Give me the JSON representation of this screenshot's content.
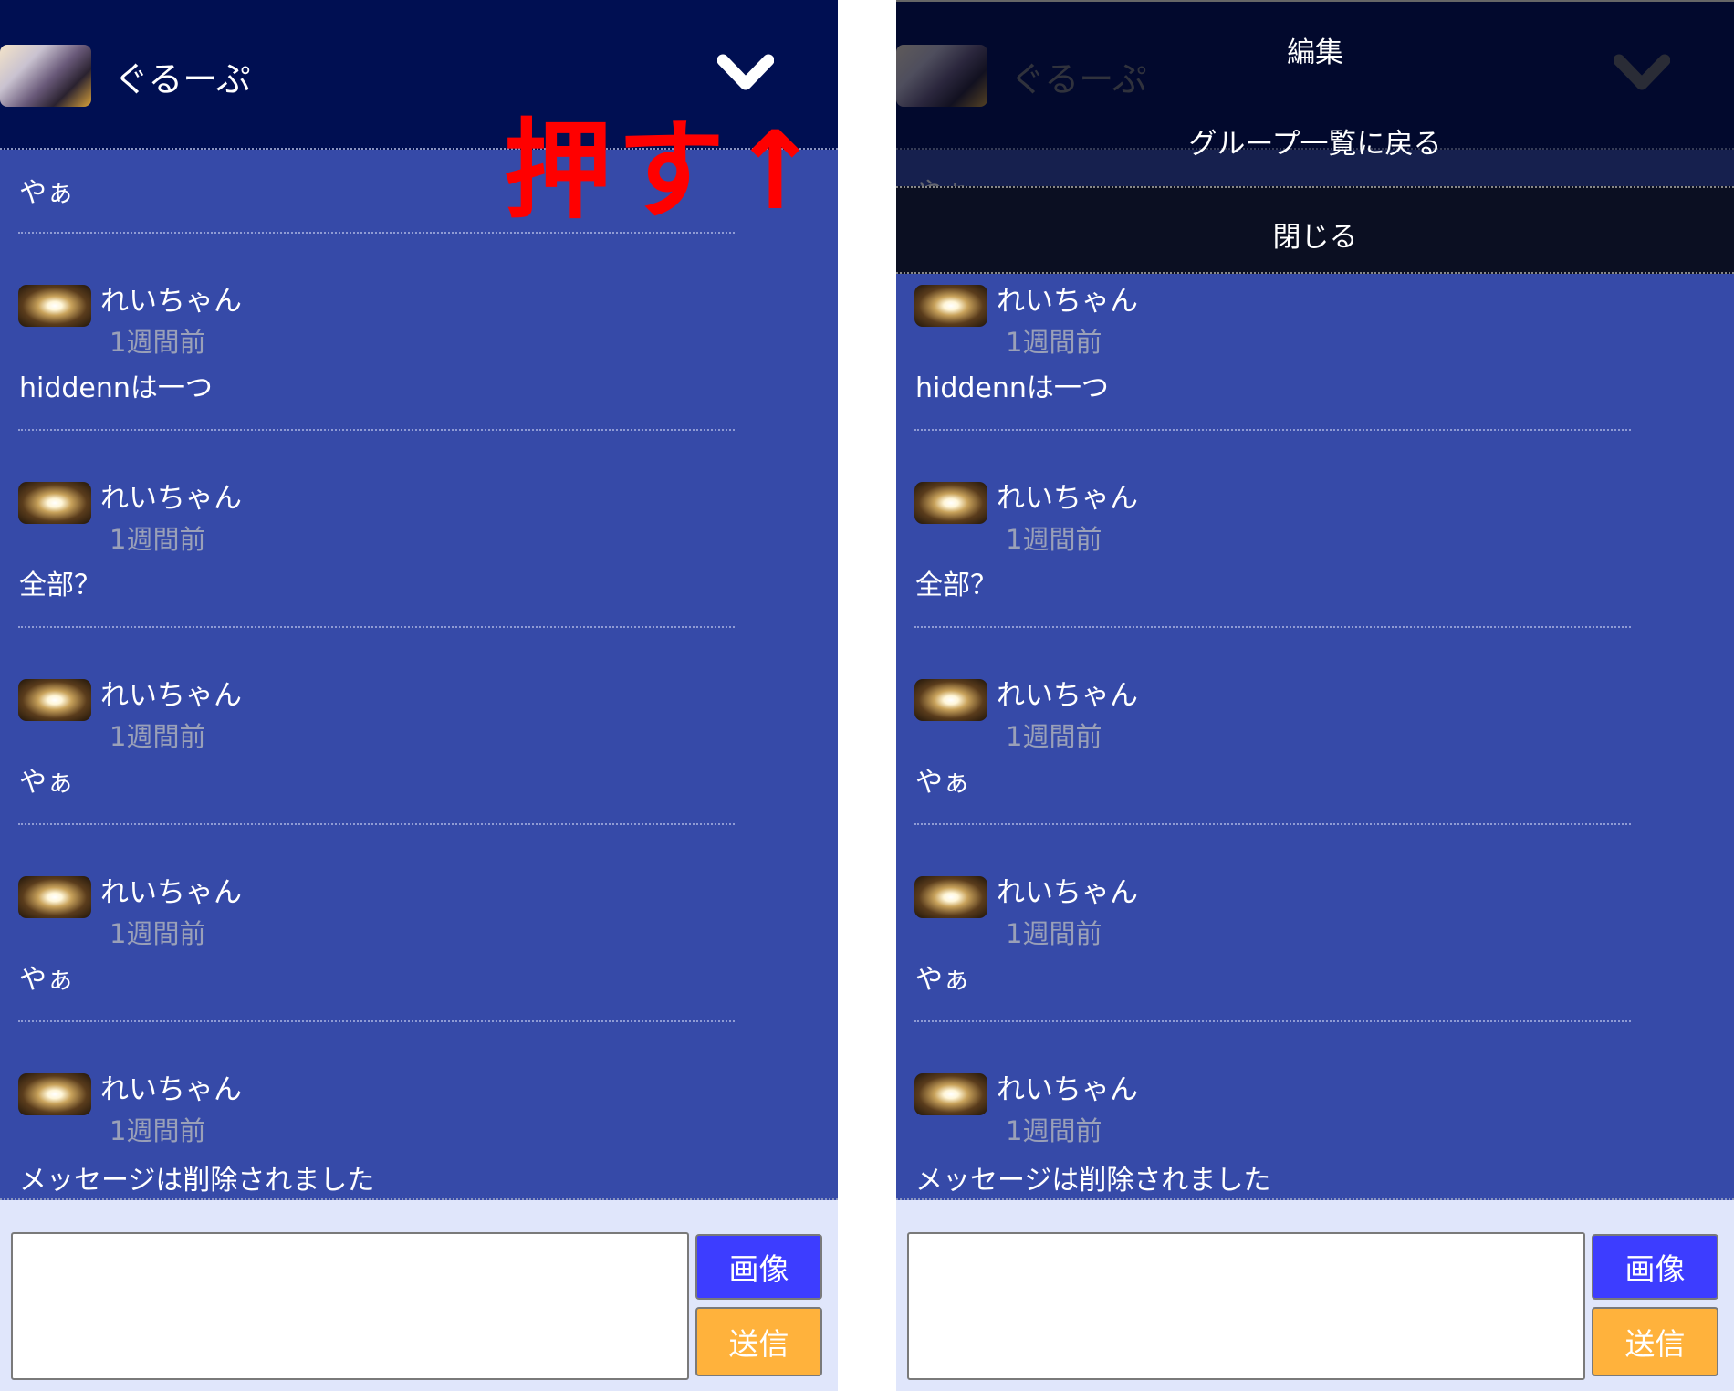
{
  "header": {
    "title": "ぐるーぷ",
    "menu_icon": "chevron-down-icon"
  },
  "annotation": {
    "text": "押す↑",
    "color": "#ff0000"
  },
  "first_message": {
    "text": "やぁ"
  },
  "messages": [
    {
      "user": "れいちゃん",
      "time": "1週間前",
      "text": "hiddennは一つ"
    },
    {
      "user": "れいちゃん",
      "time": "1週間前",
      "text": "全部？"
    },
    {
      "user": "れいちゃん",
      "time": "1週間前",
      "text": "やぁ"
    },
    {
      "user": "れいちゃん",
      "time": "1週間前",
      "text": "やぁ"
    },
    {
      "user": "れいちゃん",
      "time": "1週間前",
      "text": "メッセージは削除されました"
    }
  ],
  "composer": {
    "image_label": "画像",
    "send_label": "送信",
    "value": ""
  },
  "menu": {
    "items": [
      "編集",
      "グループ一覧に戻る",
      "閉じる"
    ]
  },
  "colors": {
    "header": "#000f52",
    "messages_bg": "#364aa8",
    "composer_bg": "#e0e6fb",
    "image_button": "#3d3dff",
    "send_button": "#ffb23c"
  }
}
